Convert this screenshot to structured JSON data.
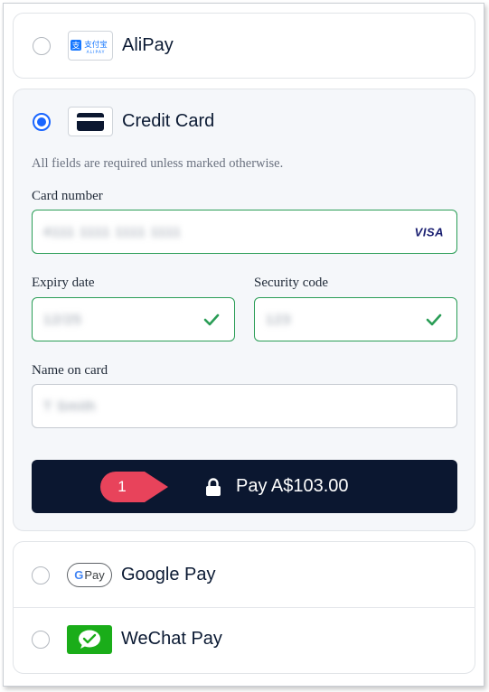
{
  "methods": {
    "alipay": {
      "label": "AliPay",
      "logo_text_cn": "支付宝",
      "logo_text_en": "ALIPAY",
      "selected": false
    },
    "credit_card": {
      "label": "Credit Card",
      "selected": true
    },
    "google_pay": {
      "label": "Google Pay",
      "logo_text": "Pay",
      "selected": false
    },
    "wechat_pay": {
      "label": "WeChat Pay",
      "selected": false
    }
  },
  "form": {
    "hint": "All fields are required unless marked otherwise.",
    "card_number": {
      "label": "Card number",
      "value": "4111 1111 1111 1111",
      "brand": "VISA"
    },
    "expiry": {
      "label": "Expiry date",
      "value": "12/25"
    },
    "security": {
      "label": "Security code",
      "value": "123"
    },
    "name": {
      "label": "Name on card",
      "value": "T Smith"
    }
  },
  "pay_button": {
    "label": "Pay A$103.00"
  },
  "annotation": {
    "number": "1"
  },
  "colors": {
    "accent": "#1a66ff",
    "button_bg": "#0b1730",
    "valid": "#2a9d56",
    "marker": "#e8435b",
    "wechat_green": "#1aad19"
  }
}
